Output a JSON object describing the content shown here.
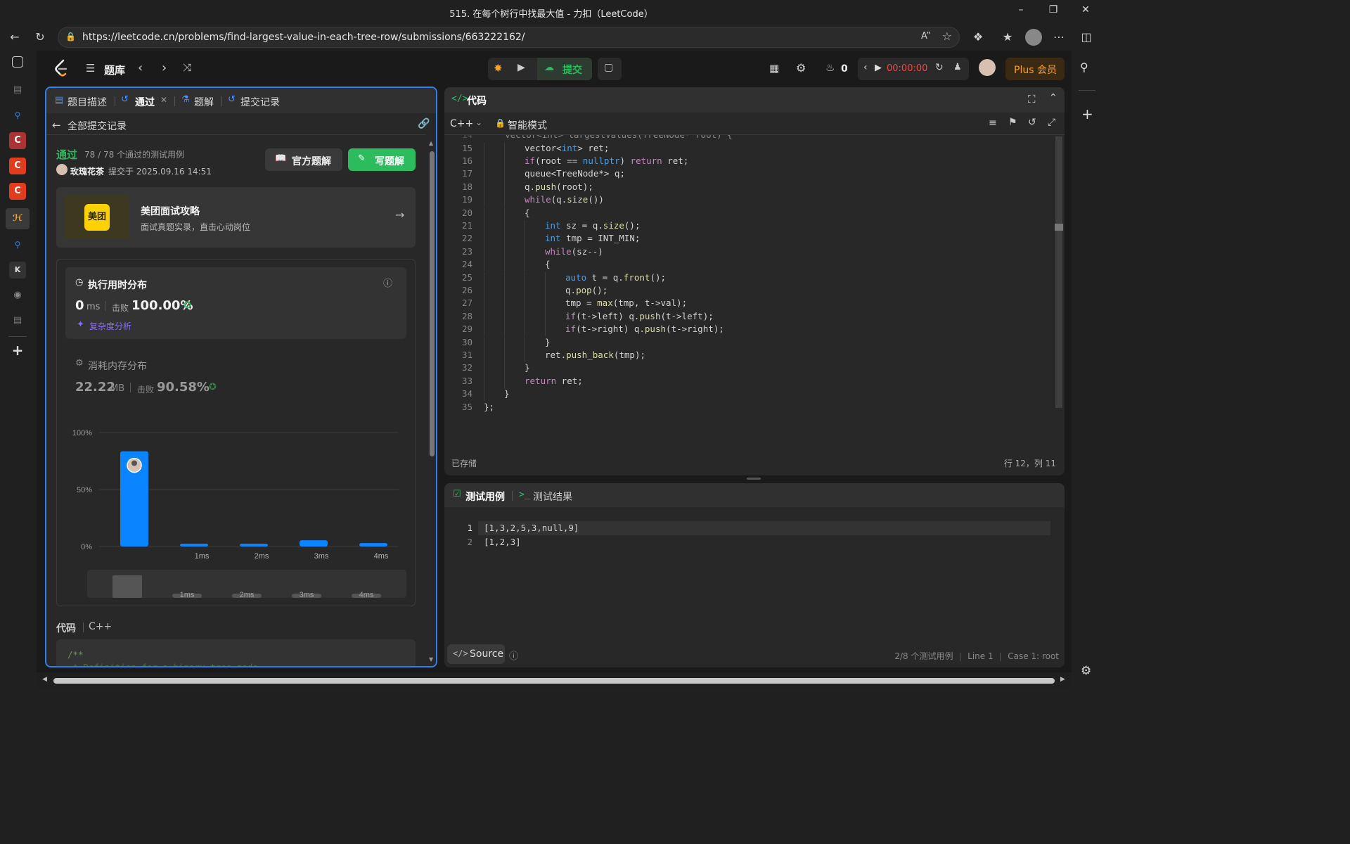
{
  "browser": {
    "title": "515. 在每个树行中找最大值 - 力扣（LeetCode）",
    "url": "https://leetcode.cn/problems/find-largest-value-in-each-tree-row/submissions/663222162/"
  },
  "topnav": {
    "problem_list": "题库",
    "submit": "提交",
    "streak": "0",
    "timer": "00:00:00",
    "plus": "Plus 会员"
  },
  "left": {
    "tabs": [
      "题目描述",
      "通过",
      "题解",
      "提交记录"
    ],
    "back": "全部提交记录",
    "status": "通过",
    "passed": "78 / 78 个通过的测试用例",
    "user": "玫瑰花茶",
    "submitted_at": "提交于 2025.09.16 14:51",
    "official_btn": "官方题解",
    "write_btn": "写题解",
    "ad_title": "美团面试攻略",
    "ad_sub": "面试真题实录，直击心动岗位",
    "ad_logo": "美团",
    "runtime_title": "执行用时分布",
    "runtime_value": "0",
    "runtime_unit": "ms",
    "beat_label": "击败",
    "runtime_beat": "100.00%",
    "complexity": "复杂度分析",
    "memory_title": "消耗内存分布",
    "memory_value": "22.22",
    "memory_unit": "MB",
    "memory_beat": "90.58%",
    "code_label": "代码",
    "lang": "C++",
    "code_preview": [
      "/**",
      " * Definition for a binary tree node."
    ]
  },
  "chart_data": {
    "type": "bar",
    "categories": [
      "",
      "1ms",
      "2ms",
      "3ms",
      "4ms"
    ],
    "values": [
      83.6,
      2.5,
      2.5,
      5.5,
      3.0
    ],
    "yticks": [
      "100%",
      "50%",
      "0%"
    ],
    "ylim": [
      0,
      100
    ],
    "highlight_index": 0,
    "bar_color": "#0a84ff",
    "minimap_labels": [
      "1ms",
      "2ms",
      "3ms",
      "4ms"
    ]
  },
  "editor": {
    "title": "代码",
    "lang": "C++",
    "mode": "智能模式",
    "saved": "已存储",
    "cursor": "行 12，列 11",
    "first_line": "    vector<int> largestValues(TreeNode* root) {",
    "lines": [
      {
        "n": "15",
        "indent": 2,
        "html": "vector&lt;<span class='kw'>int</span>&gt; ret;"
      },
      {
        "n": "16",
        "indent": 2,
        "html": "<span class='kw2'>if</span>(root == <span class='kw'>nullptr</span>) <span class='kw2'>return</span> ret;"
      },
      {
        "n": "17",
        "indent": 2,
        "html": "queue&lt;TreeNode*&gt; q;"
      },
      {
        "n": "18",
        "indent": 2,
        "html": "q.<span class='fn'>push</span>(root);"
      },
      {
        "n": "19",
        "indent": 2,
        "html": "<span class='kw2'>while</span>(q.<span class='fn'>size</span>())"
      },
      {
        "n": "20",
        "indent": 2,
        "html": "{"
      },
      {
        "n": "21",
        "indent": 3,
        "html": "<span class='kw'>int</span> sz = q.<span class='fn'>size</span>();"
      },
      {
        "n": "22",
        "indent": 3,
        "html": "<span class='kw'>int</span> tmp = INT_MIN;"
      },
      {
        "n": "23",
        "indent": 3,
        "html": "<span class='kw2'>while</span>(sz--)"
      },
      {
        "n": "24",
        "indent": 3,
        "html": "{"
      },
      {
        "n": "25",
        "indent": 4,
        "html": "<span class='kw'>auto</span> t = q.<span class='fn'>front</span>();"
      },
      {
        "n": "26",
        "indent": 4,
        "html": "q.<span class='fn'>pop</span>();"
      },
      {
        "n": "27",
        "indent": 4,
        "html": "tmp = <span class='fn'>max</span>(tmp, t-&gt;val);"
      },
      {
        "n": "28",
        "indent": 4,
        "html": "<span class='kw2'>if</span>(t-&gt;left) q.<span class='fn'>push</span>(t-&gt;left);"
      },
      {
        "n": "29",
        "indent": 4,
        "html": "<span class='kw2'>if</span>(t-&gt;right) q.<span class='fn'>push</span>(t-&gt;right);"
      },
      {
        "n": "30",
        "indent": 3,
        "html": "}"
      },
      {
        "n": "31",
        "indent": 3,
        "html": "ret.<span class='fn'>push_back</span>(tmp);"
      },
      {
        "n": "32",
        "indent": 2,
        "html": "}"
      },
      {
        "n": "33",
        "indent": 2,
        "html": "<span class='kw2'>return</span> ret;"
      },
      {
        "n": "34",
        "indent": 1,
        "html": "}"
      },
      {
        "n": "35",
        "indent": 0,
        "html": "};"
      }
    ]
  },
  "tests": {
    "tab1": "测试用例",
    "tab2": "测试结果",
    "lines": [
      {
        "n": "1",
        "text": "[1,3,2,5,3,null,9]"
      },
      {
        "n": "2",
        "text": "[1,2,3]"
      }
    ],
    "source": "Source",
    "status": [
      "2/8 个测试用例",
      "Line 1",
      "Case 1: root"
    ]
  }
}
